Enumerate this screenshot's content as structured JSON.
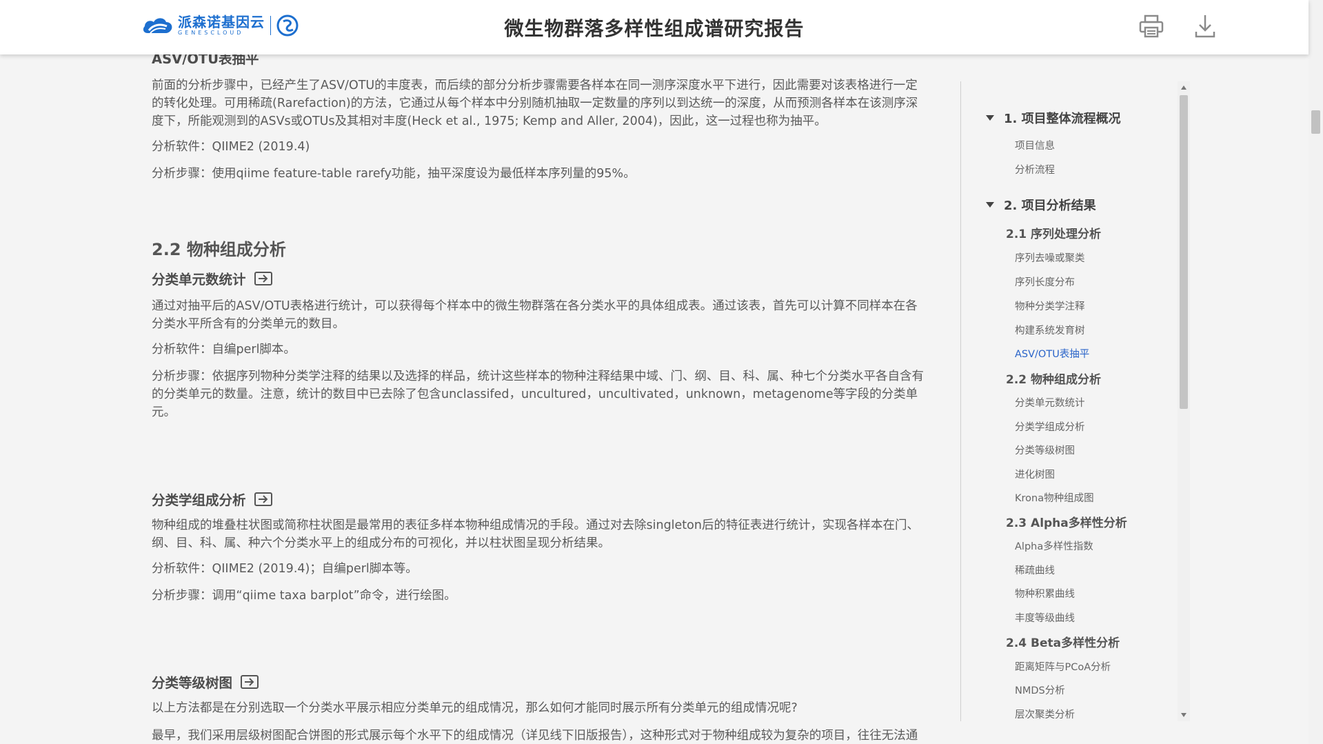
{
  "header": {
    "logo_cn": "派森诺基因云",
    "logo_en": "GENESCLOUD",
    "title": "微生物群落多样性组成谱研究报告",
    "print_icon": "printer-icon",
    "download_icon": "download-icon"
  },
  "doc": {
    "prev_heading": "ASV/OTU表抽平",
    "p1": "前面的分析步骤中，已经产生了ASV/OTU的丰度表，而后续的部分分析步骤需要各样本在同一测序深度水平下进行，因此需要对该表格进行一定的转化处理。可用稀疏(Rarefaction)的方法，它通过从每个样本中分别随机抽取一定数量的序列以到达统一的深度，从而预测各样本在该测序深度下，所能观测到的ASVs或OTUs及其相对丰度(Heck et al., 1975; Kemp and Aller, 2004)，因此，这一过程也称为抽平。",
    "p2": "分析软件：QIIME2 (2019.4)",
    "p3": "分析步骤：使用qiime feature-table rarefy功能，抽平深度设为最低样本序列量的95%。",
    "section_title": "2.2 物种组成分析",
    "s1_title": "分类单元数统计",
    "s1_p1": "通过对抽平后的ASV/OTU表格进行统计，可以获得每个样本中的微生物群落在各分类水平的具体组成表。通过该表，首先可以计算不同样本在各分类水平所含有的分类单元的数目。",
    "s1_p2": "分析软件：自编perl脚本。",
    "s1_p3": "分析步骤：依据序列物种分类学注释的结果以及选择的样品，统计这些样本的物种注释结果中域、门、纲、目、科、属、种七个分类水平各自含有的分类单元的数量。注意，统计的数目中已去除了包含unclassifed，uncultured，uncultivated，unknown，metagenome等字段的分类单元。",
    "s2_title": "分类学组成分析",
    "s2_p1": "物种组成的堆叠柱状图或简称柱状图是最常用的表征多样本物种组成情况的手段。通过对去除singleton后的特征表进行统计，实现各样本在门、纲、目、科、属、种六个分类水平上的组成分布的可视化，并以柱状图呈现分析结果。",
    "s2_p2": "分析软件：QIIME2 (2019.4)；自编perl脚本等。",
    "s2_p3": "分析步骤：调用“qiime taxa barplot”命令，进行绘图。",
    "s3_title": "分类等级树图",
    "s3_p1": "以上方法都是在分别选取一个分类水平展示相应分类单元的组成情况，那么如何才能同时展示所有分类单元的组成情况呢?",
    "s3_p2": "最早，我们采用层级树图配合饼图的形式展示每个水平下的组成情况（详见线下旧版报告），这种形式对于物种组成较为复杂的项目，往往无法通"
  },
  "toc": {
    "sec1": "1. 项目整体流程概况",
    "sec1_items": [
      "项目信息",
      "分析流程"
    ],
    "sec2": "2. 项目分析结果",
    "sub21": "2.1 序列处理分析",
    "sub21_items": [
      "序列去噪或聚类",
      "序列长度分布",
      "物种分类学注释",
      "构建系统发育树",
      "ASV/OTU表抽平"
    ],
    "sub22": "2.2 物种组成分析",
    "sub22_items": [
      "分类单元数统计",
      "分类学组成分析",
      "分类等级树图",
      "进化树图",
      "Krona物种组成图"
    ],
    "sub23": "2.3 Alpha多样性分析",
    "sub23_items": [
      "Alpha多样性指数",
      "稀疏曲线",
      "物种积累曲线",
      "丰度等级曲线"
    ],
    "sub24": "2.4 Beta多样性分析",
    "sub24_items": [
      "距离矩阵与PCoA分析",
      "NMDS分析",
      "层次聚类分析"
    ],
    "active_item": "ASV/OTU表抽平"
  },
  "colors": {
    "brand": "#1d6fcf",
    "active": "#2a64c9"
  }
}
